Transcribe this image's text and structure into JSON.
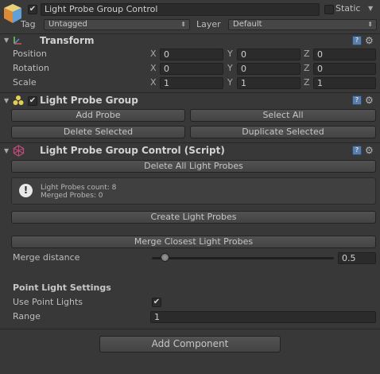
{
  "header": {
    "object_name": "Light Probe Group Control",
    "active": true,
    "static_label": "Static",
    "tag_label": "Tag",
    "tag_value": "Untagged",
    "layer_label": "Layer",
    "layer_value": "Default"
  },
  "transform": {
    "title": "Transform",
    "rows": [
      {
        "label": "Position",
        "x": "0",
        "y": "0",
        "z": "0"
      },
      {
        "label": "Rotation",
        "x": "0",
        "y": "0",
        "z": "0"
      },
      {
        "label": "Scale",
        "x": "1",
        "y": "1",
        "z": "1"
      }
    ],
    "axis_x": "X",
    "axis_y": "Y",
    "axis_z": "Z"
  },
  "light_probe_group": {
    "title": "Light Probe Group",
    "enabled": true,
    "add_probe": "Add Probe",
    "select_all": "Select All",
    "delete_selected": "Delete Selected",
    "duplicate_selected": "Duplicate Selected"
  },
  "script": {
    "title": "Light Probe Group Control (Script)",
    "delete_all": "Delete All Light Probes",
    "info_icon": "!",
    "info_line1": "Light Probes count: 8",
    "info_line2": "Merged Probes: 0",
    "create": "Create Light Probes",
    "merge": "Merge Closest Light Probes",
    "merge_distance_label": "Merge distance",
    "merge_distance_value": "0.5",
    "merge_distance_fraction": 0.05,
    "point_light_heading": "Point Light Settings",
    "use_point_lights_label": "Use Point Lights",
    "use_point_lights": true,
    "range_label": "Range",
    "range_value": "1"
  },
  "add_component": "Add Component",
  "icons": {
    "check": "✔",
    "fold": "▼",
    "dropdown": "⬍",
    "help": "?",
    "gear": "⚙"
  },
  "colors": {
    "background": "#383838",
    "field": "#2b2b2b",
    "button": "#4a4a4a"
  }
}
